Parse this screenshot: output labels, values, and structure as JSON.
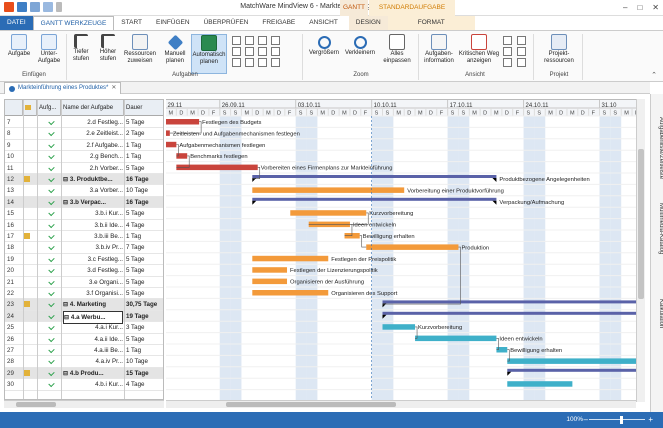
{
  "app": {
    "title": "MatchWare MindView 6 - Markteinführung eines Produktes",
    "context_gantt": "GANTT",
    "context_standard": "STANDARDAUFGABE",
    "win_minimize": "–",
    "win_maximize": "□",
    "win_close": "✕"
  },
  "tabs": [
    "DATEI",
    "GANTT WERKZEUGE",
    "START",
    "EINFÜGEN",
    "ÜBERPRÜFEN",
    "FREIGABE",
    "ANSICHT",
    "DESIGN",
    "FORMAT"
  ],
  "ribbon": {
    "buttons": [
      {
        "label": "Aufgabe",
        "icon": "add-task-icon"
      },
      {
        "label": "Unter-Aufgabe",
        "icon": "add-subtask-icon"
      },
      {
        "label": "Tiefer stufen",
        "icon": "demote-icon"
      },
      {
        "label": "Höher stufen",
        "icon": "promote-icon"
      },
      {
        "label": "Ressourcen zuweisen",
        "icon": "resources-icon"
      },
      {
        "label": "Manuell planen",
        "icon": "pin-icon"
      },
      {
        "label": "Automatisch planen",
        "icon": "auto-schedule-icon"
      },
      {
        "label": "Vergrößern",
        "icon": "zoom-in-icon"
      },
      {
        "label": "Verkleinern",
        "icon": "zoom-out-icon"
      },
      {
        "label": "Alles einpassen",
        "icon": "fit-all-icon"
      },
      {
        "label": "Aufgaben-information",
        "icon": "task-info-icon"
      },
      {
        "label": "Kritischen Weg anzeigen",
        "icon": "critical-path-icon"
      },
      {
        "label": "Projekt-ressourcen",
        "icon": "project-resources-icon"
      }
    ],
    "groups": [
      "Einfügen",
      "Aufgaben",
      "Zoom",
      "Ansicht",
      "Projekt"
    ]
  },
  "doc_tab": "Markteinführung eines Produktes*",
  "side_panels": [
    "Aufgabenliste/Zeitleiste",
    "Multimedia-Katalog",
    "Kalkulation"
  ],
  "grid": {
    "headers": [
      "Aufg...",
      "Name der Aufgabe",
      "Dauer"
    ],
    "rows": [
      {
        "num": "7",
        "name": "2.d Festleg...",
        "dur": "5 Tage",
        "summary": false,
        "flag": false
      },
      {
        "num": "8",
        "name": "2.e Zeitleist...",
        "dur": "2 Tage",
        "summary": false,
        "flag": false
      },
      {
        "num": "9",
        "name": "2.f Aufgabe...",
        "dur": "1 Tag",
        "summary": false,
        "flag": false
      },
      {
        "num": "10",
        "name": "2.g Bench...",
        "dur": "1 Tag",
        "summary": false,
        "flag": false
      },
      {
        "num": "11",
        "name": "2.h Vorber...",
        "dur": "5 Tage",
        "summary": false,
        "flag": false
      },
      {
        "num": "12",
        "name": "⊟ 3. Produktbe...",
        "dur": "16 Tage",
        "summary": true,
        "flag": true
      },
      {
        "num": "13",
        "name": "3.a Vorber...",
        "dur": "10 Tage",
        "summary": false,
        "flag": false
      },
      {
        "num": "14",
        "name": "⊟ 3.b Verpac...",
        "dur": "16 Tage",
        "summary": true,
        "flag": false
      },
      {
        "num": "15",
        "name": "3.b.i Kur...",
        "dur": "5 Tage",
        "summary": false,
        "flag": false
      },
      {
        "num": "16",
        "name": "3.b.ii Ide...",
        "dur": "4 Tage",
        "summary": false,
        "flag": false
      },
      {
        "num": "17",
        "name": "3.b.iii Be...",
        "dur": "1 Tag",
        "summary": false,
        "flag": true
      },
      {
        "num": "18",
        "name": "3.b.iv Pr...",
        "dur": "7 Tage",
        "summary": false,
        "flag": false
      },
      {
        "num": "19",
        "name": "3.c Festleg...",
        "dur": "5 Tage",
        "summary": false,
        "flag": false
      },
      {
        "num": "20",
        "name": "3.d Festleg...",
        "dur": "5 Tage",
        "summary": false,
        "flag": false
      },
      {
        "num": "21",
        "name": "3.e Organi...",
        "dur": "5 Tage",
        "summary": false,
        "flag": false
      },
      {
        "num": "22",
        "name": "3.f Organisi...",
        "dur": "5 Tage",
        "summary": false,
        "flag": false
      },
      {
        "num": "23",
        "name": "⊟ 4. Marketing",
        "dur": "30,75 Tage",
        "summary": true,
        "flag": true
      },
      {
        "num": "24",
        "name": "⊟ 4.a Werbu...",
        "dur": "19 Tage",
        "summary": true,
        "flag": false
      },
      {
        "num": "25",
        "name": "4.a.i Kur...",
        "dur": "3 Tage",
        "summary": false,
        "flag": false
      },
      {
        "num": "26",
        "name": "4.a.ii Ide...",
        "dur": "5 Tage",
        "summary": false,
        "flag": false
      },
      {
        "num": "27",
        "name": "4.a.iii Be...",
        "dur": "1 Tag",
        "summary": false,
        "flag": false
      },
      {
        "num": "28",
        "name": "4.a.iv Pr...",
        "dur": "10 Tage",
        "summary": false,
        "flag": false
      },
      {
        "num": "29",
        "name": "⊟ 4.b Produ...",
        "dur": "15 Tage",
        "summary": true,
        "flag": true
      },
      {
        "num": "30",
        "name": "4.b.i Kur...",
        "dur": "4 Tage",
        "summary": false,
        "flag": false
      }
    ]
  },
  "timescale": {
    "weeks": [
      "29.11",
      "26.09.11",
      "03.10.11",
      "10.10.11",
      "17.10.11",
      "24.10.11",
      "31.10"
    ],
    "day_letters": "MDMDFSSMDMDFSSMDMDFSSMDMDFSSMDMDFSSMDMDFSSMDMDFSSMDMDFSSMDMDFSSMDMDFSSM"
  },
  "gantt_labels": [
    "Festlegen des Budgets",
    "Zeitleisten- und Aufgabenmechanismen festlegen",
    "Aufgabenmechanismen festlegen",
    "Benchmarks festlegen",
    "Vorbereiten eines Firmenplans zur Markteinführung",
    "Produktbezogene Angelegenheiten",
    "Vorbereitung einer Produktvorführung",
    "Verpackung/Aufmachung",
    "Kurzvorbereitung",
    "Ideen entwickeln",
    "Bewilligung erhalten",
    "Produktion",
    "Festlegen der Preispolitik",
    "Festlegen der Lizenzierungspolitik",
    "Organisieren der Ausführung",
    "Organisieren des Support",
    "Kurzvorbereitung",
    "Ideen entwickeln",
    "Bewilligung erhalten"
  ],
  "colors": {
    "red": "#c9443c",
    "orange": "#f39a3a",
    "teal": "#3fb0c9",
    "summary": "#5a62a8",
    "weekend": "#dde7f3",
    "accent": "#2b6cb5"
  },
  "status": {
    "zoom": "100%",
    "minus": "–",
    "plus": "+"
  }
}
